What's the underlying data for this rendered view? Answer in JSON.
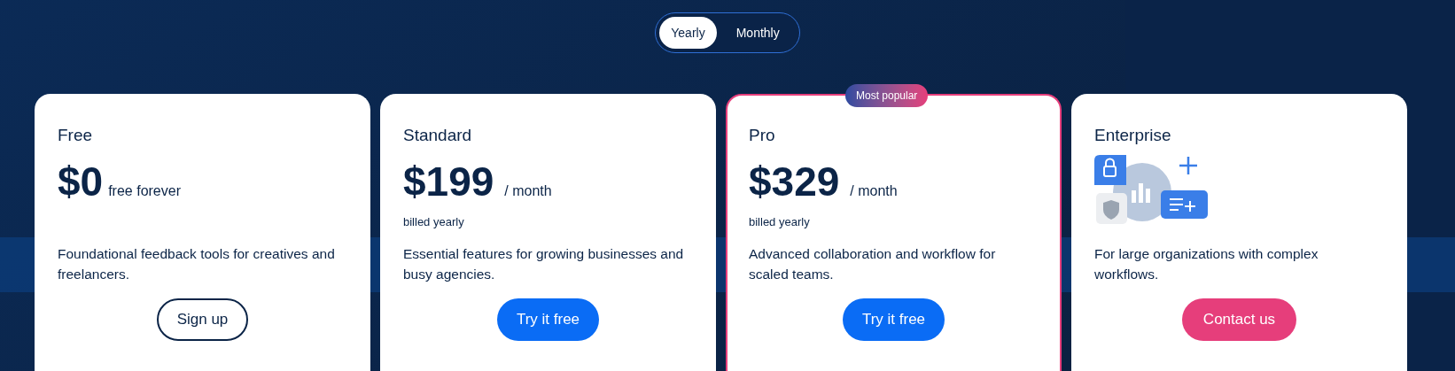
{
  "billing_toggle": [
    {
      "label": "Yearly",
      "selected": true
    },
    {
      "label": "Monthly",
      "selected": false
    }
  ],
  "plans": [
    {
      "name": "Free",
      "price": "$0",
      "period": "free forever",
      "description": "Foundational feedback tools for creatives and freelancers.",
      "button": {
        "label": "Sign up",
        "kind": "outline"
      },
      "highlighted": false
    },
    {
      "name": "Standard",
      "price": "$199",
      "period": "/ month",
      "billing_note": "billed yearly",
      "description": "Essential features for growing businesses and busy agencies.",
      "button": {
        "label": "Try it free",
        "kind": "primary"
      },
      "highlighted": false
    },
    {
      "name": "Pro",
      "price": "$329",
      "period": "/ month",
      "billing_note": "billed yearly",
      "badge": "Most popular",
      "description": "Advanced collaboration and workflow for scaled teams.",
      "button": {
        "label": "Try it free",
        "kind": "primary"
      },
      "highlighted": true
    },
    {
      "name": "Enterprise",
      "kind": "illustration",
      "description": "For large organizations with complex workflows.",
      "button": {
        "label": "Contact us",
        "kind": "accent"
      },
      "highlighted": false
    }
  ]
}
